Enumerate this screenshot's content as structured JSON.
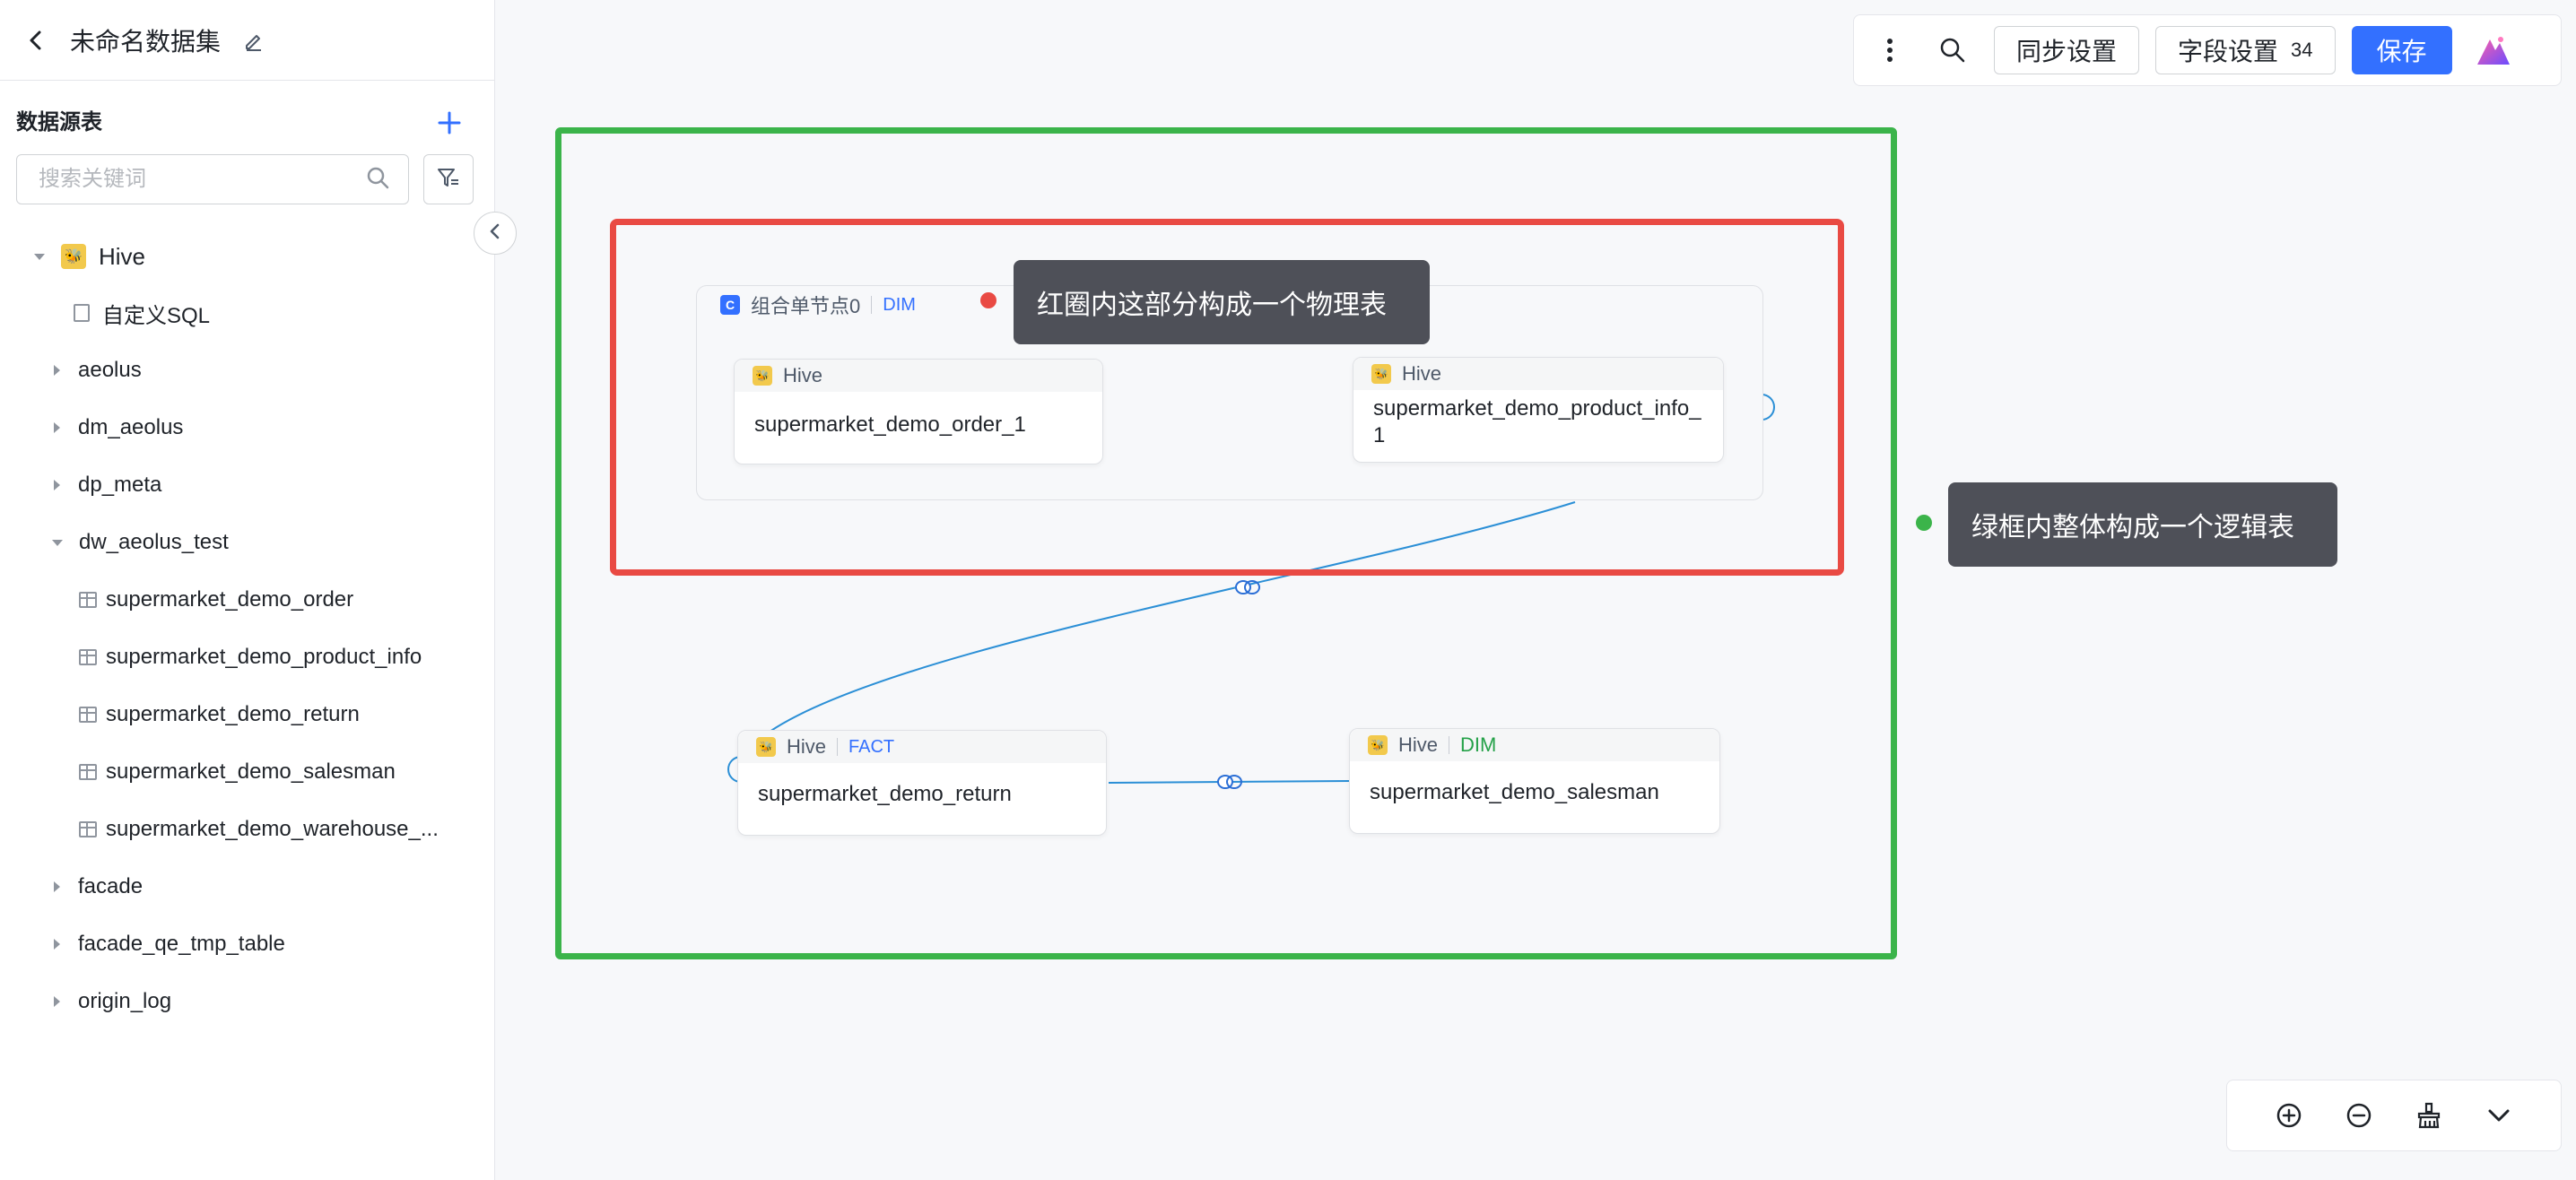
{
  "dataset": {
    "title": "未命名数据集"
  },
  "sidebar": {
    "section_title": "数据源表",
    "search_placeholder": "搜索关键词",
    "tree": [
      {
        "label": "Hive",
        "type": "source"
      },
      {
        "label": "自定义SQL",
        "type": "sql"
      },
      {
        "label": "aeolus",
        "type": "db"
      },
      {
        "label": "dm_aeolus",
        "type": "db"
      },
      {
        "label": "dp_meta",
        "type": "db"
      },
      {
        "label": "dw_aeolus_test",
        "type": "db-open"
      },
      {
        "label": "supermarket_demo_order",
        "type": "table"
      },
      {
        "label": "supermarket_demo_product_info",
        "type": "table"
      },
      {
        "label": "supermarket_demo_return",
        "type": "table"
      },
      {
        "label": "supermarket_demo_salesman",
        "type": "table"
      },
      {
        "label": "supermarket_demo_warehouse_...",
        "type": "table"
      },
      {
        "label": "facade",
        "type": "db"
      },
      {
        "label": "facade_qe_tmp_table",
        "type": "db"
      },
      {
        "label": "origin_log",
        "type": "db"
      }
    ]
  },
  "toolbar": {
    "sync_label": "同步设置",
    "field_label": "字段设置",
    "field_count": "34",
    "save_label": "保存"
  },
  "canvas": {
    "combo": {
      "title": "组合单节点0",
      "tag": "DIM"
    },
    "nodes": [
      {
        "source": "Hive",
        "tag": "",
        "name": "supermarket_demo_order_1"
      },
      {
        "source": "Hive",
        "tag": "",
        "name": "supermarket_demo_product_info_1"
      },
      {
        "source": "Hive",
        "tag": "FACT",
        "name": "supermarket_demo_return"
      },
      {
        "source": "Hive",
        "tag": "DIM",
        "name": "supermarket_demo_salesman"
      }
    ],
    "annotations": {
      "red": "红圈内这部分构成一个物理表",
      "green": "绿框内整体构成一个逻辑表"
    }
  },
  "colors": {
    "accent": "#3370ff",
    "green_frame": "#3bb44a",
    "red_frame": "#e94a43",
    "tooltip_bg": "#4e5058",
    "hive_badge": "#f2c94c"
  }
}
